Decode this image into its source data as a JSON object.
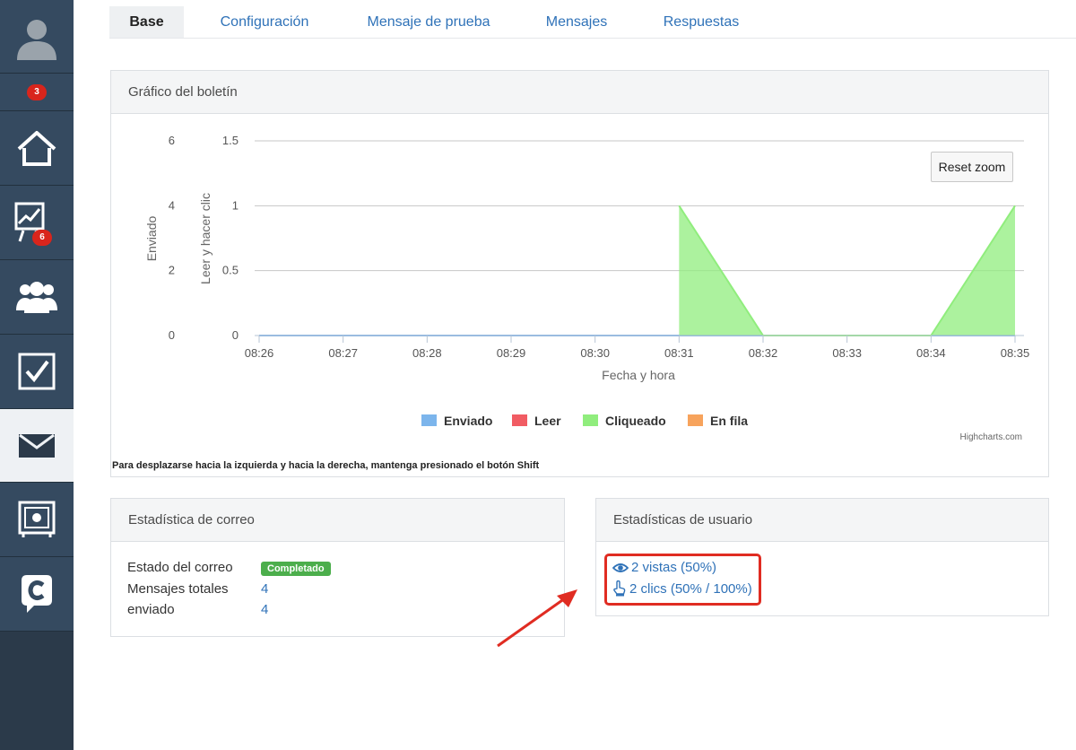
{
  "sidebar": {
    "badges": {
      "reports": "3",
      "stats": "6"
    },
    "items": [
      "avatar-icon",
      "home-icon",
      "chart-presentation-icon",
      "users-icon",
      "checkbox-icon",
      "mail-icon",
      "vault-icon",
      "chat-c-icon"
    ]
  },
  "tabs": [
    "Base",
    "Configuración",
    "Mensaje de prueba",
    "Mensajes",
    "Respuestas"
  ],
  "chart_panel": {
    "title": "Gráfico del boletín",
    "reset_zoom": "Reset zoom",
    "credits": "Highcharts.com",
    "note": "Para desplazarse hacia la izquierda y hacia la derecha, mantenga presionado el botón Shift"
  },
  "chart_data": {
    "type": "area",
    "x": [
      "08:26",
      "08:27",
      "08:28",
      "08:29",
      "08:30",
      "08:31",
      "08:32",
      "08:33",
      "08:34",
      "08:35"
    ],
    "xlabel": "Fecha y hora",
    "y_left": {
      "label": "Enviado",
      "ticks": [
        "0",
        "2",
        "4",
        "6"
      ],
      "range": [
        0,
        6
      ]
    },
    "y_right": {
      "label": "Leer y hacer clic",
      "ticks": [
        "0",
        "0.5",
        "1",
        "1.5"
      ],
      "range": [
        0,
        1.5
      ]
    },
    "series": [
      {
        "name": "Enviado",
        "color": "#7cb5ec",
        "values": [
          0,
          0,
          0,
          0,
          0,
          0,
          0,
          0,
          0,
          0
        ]
      },
      {
        "name": "Leer",
        "color": "#f15c63",
        "values": []
      },
      {
        "name": "Cliqueado",
        "color": "#90ed7d",
        "points": [
          [
            "08:31",
            1
          ],
          [
            "08:32",
            0
          ],
          [
            "08:33",
            0
          ],
          [
            "08:34",
            0
          ],
          [
            "08:35",
            1
          ]
        ]
      },
      {
        "name": "En fila",
        "color": "#f7a35c",
        "values": []
      }
    ],
    "grid": true,
    "legend": "bottom-center"
  },
  "mail_stats": {
    "title": "Estadística de correo",
    "rows": [
      {
        "label": "Estado del correo",
        "badge": "Completado"
      },
      {
        "label": "Mensajes totales",
        "value": "4"
      },
      {
        "label": "enviado",
        "value": "4"
      }
    ]
  },
  "user_stats": {
    "title": "Estadísticas de usuario",
    "views": "2 vistas (50%)",
    "clicks": "2 clics (50% / 100%)"
  },
  "colors": {
    "accent": "#2f72b8",
    "sidebar": "#354a60",
    "highlight": "#e02c22",
    "success": "#4cae4c"
  }
}
